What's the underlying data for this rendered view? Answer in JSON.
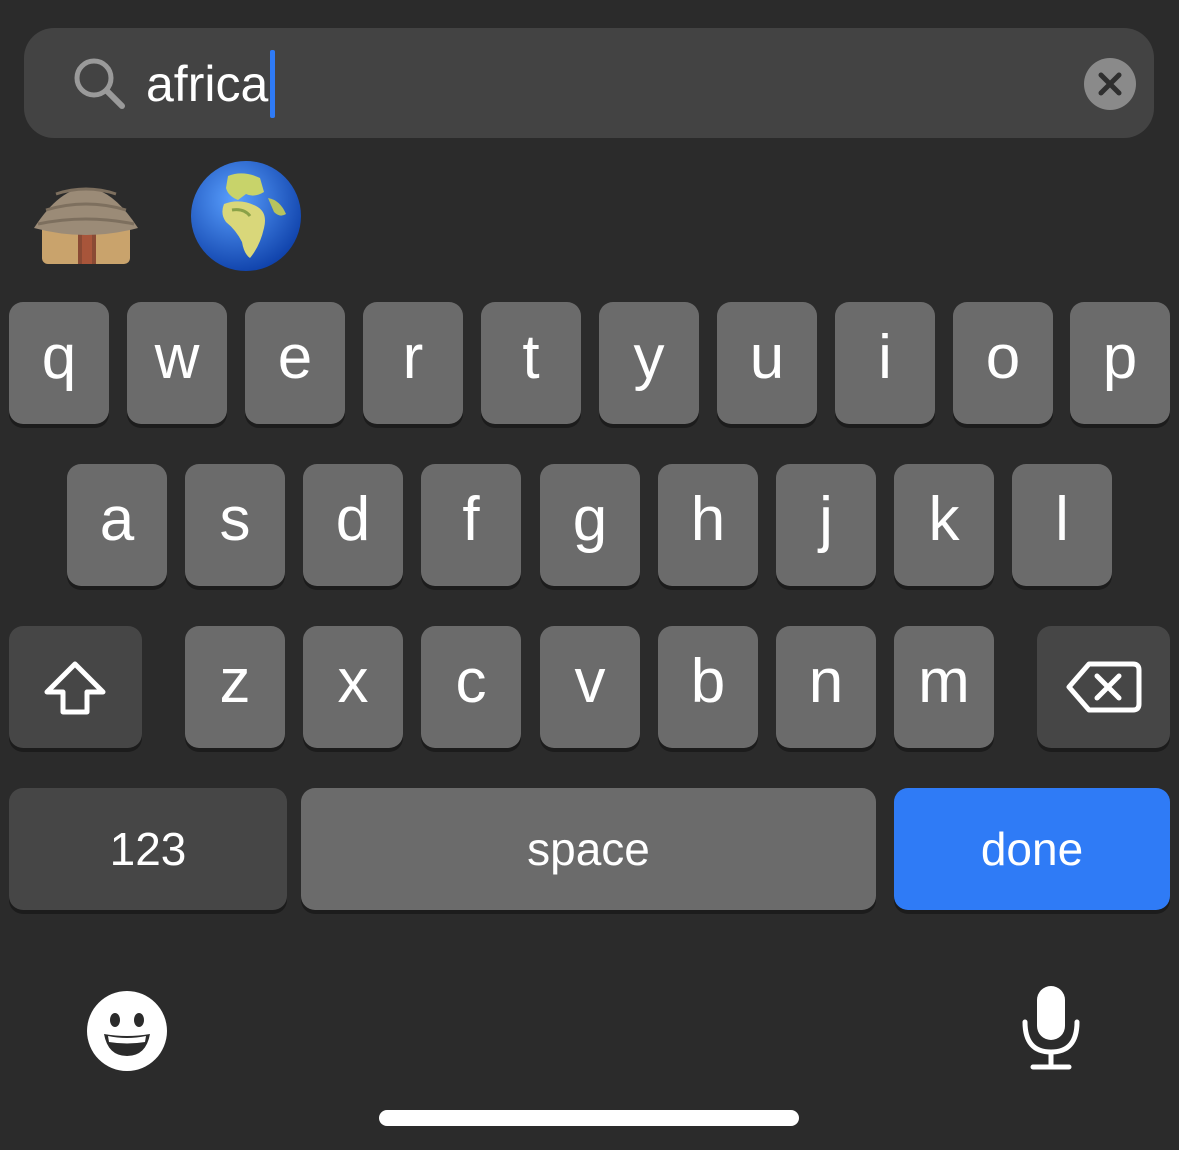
{
  "search": {
    "query": "africa",
    "icon": "search-icon",
    "clear_icon": "clear-icon"
  },
  "emoji_results": [
    {
      "name": "hut",
      "icon": "hut-emoji"
    },
    {
      "name": "globe showing Europe-Africa",
      "icon": "globe-europe-africa-emoji"
    }
  ],
  "keyboard": {
    "row1": [
      "q",
      "w",
      "e",
      "r",
      "t",
      "y",
      "u",
      "i",
      "o",
      "p"
    ],
    "row2": [
      "a",
      "s",
      "d",
      "f",
      "g",
      "h",
      "j",
      "k",
      "l"
    ],
    "row3": [
      "z",
      "x",
      "c",
      "v",
      "b",
      "n",
      "m"
    ],
    "shift_icon": "shift-icon",
    "backspace_icon": "backspace-icon",
    "numbers_label": "123",
    "space_label": "space",
    "done_label": "done",
    "emoji_icon": "emoji-smile-icon",
    "mic_icon": "microphone-icon"
  },
  "colors": {
    "background": "#2b2b2b",
    "key": "#6b6b6b",
    "key_dark": "#464646",
    "accent": "#2f7bf6",
    "search_field": "#434343"
  }
}
